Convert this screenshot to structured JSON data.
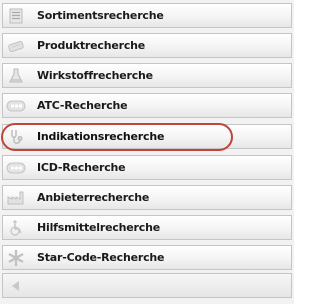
{
  "nav": {
    "items": [
      {
        "label": "Sortimentsrecherche",
        "icon": "list-document-icon"
      },
      {
        "label": "Produktrecherche",
        "icon": "blister-pack-icon"
      },
      {
        "label": "Wirkstoffrecherche",
        "icon": "flask-icon"
      },
      {
        "label": "ATC-Recherche",
        "icon": "atc-badge-icon"
      },
      {
        "label": "Indikationsrecherche",
        "icon": "stethoscope-icon"
      },
      {
        "label": "ICD-Recherche",
        "icon": "icd-badge-icon"
      },
      {
        "label": "Anbieterrecherche",
        "icon": "factory-icon"
      },
      {
        "label": "Hilfsmittelrecherche",
        "icon": "wheelchair-icon"
      },
      {
        "label": "Star-Code-Recherche",
        "icon": "star-burst-icon"
      }
    ],
    "active_item": "Indikationsrecherche",
    "collapse_icon": "collapse-left-arrow-icon"
  },
  "colors": {
    "highlight_ring": "#c1453a",
    "icon_gray": "#c8c8c8"
  }
}
